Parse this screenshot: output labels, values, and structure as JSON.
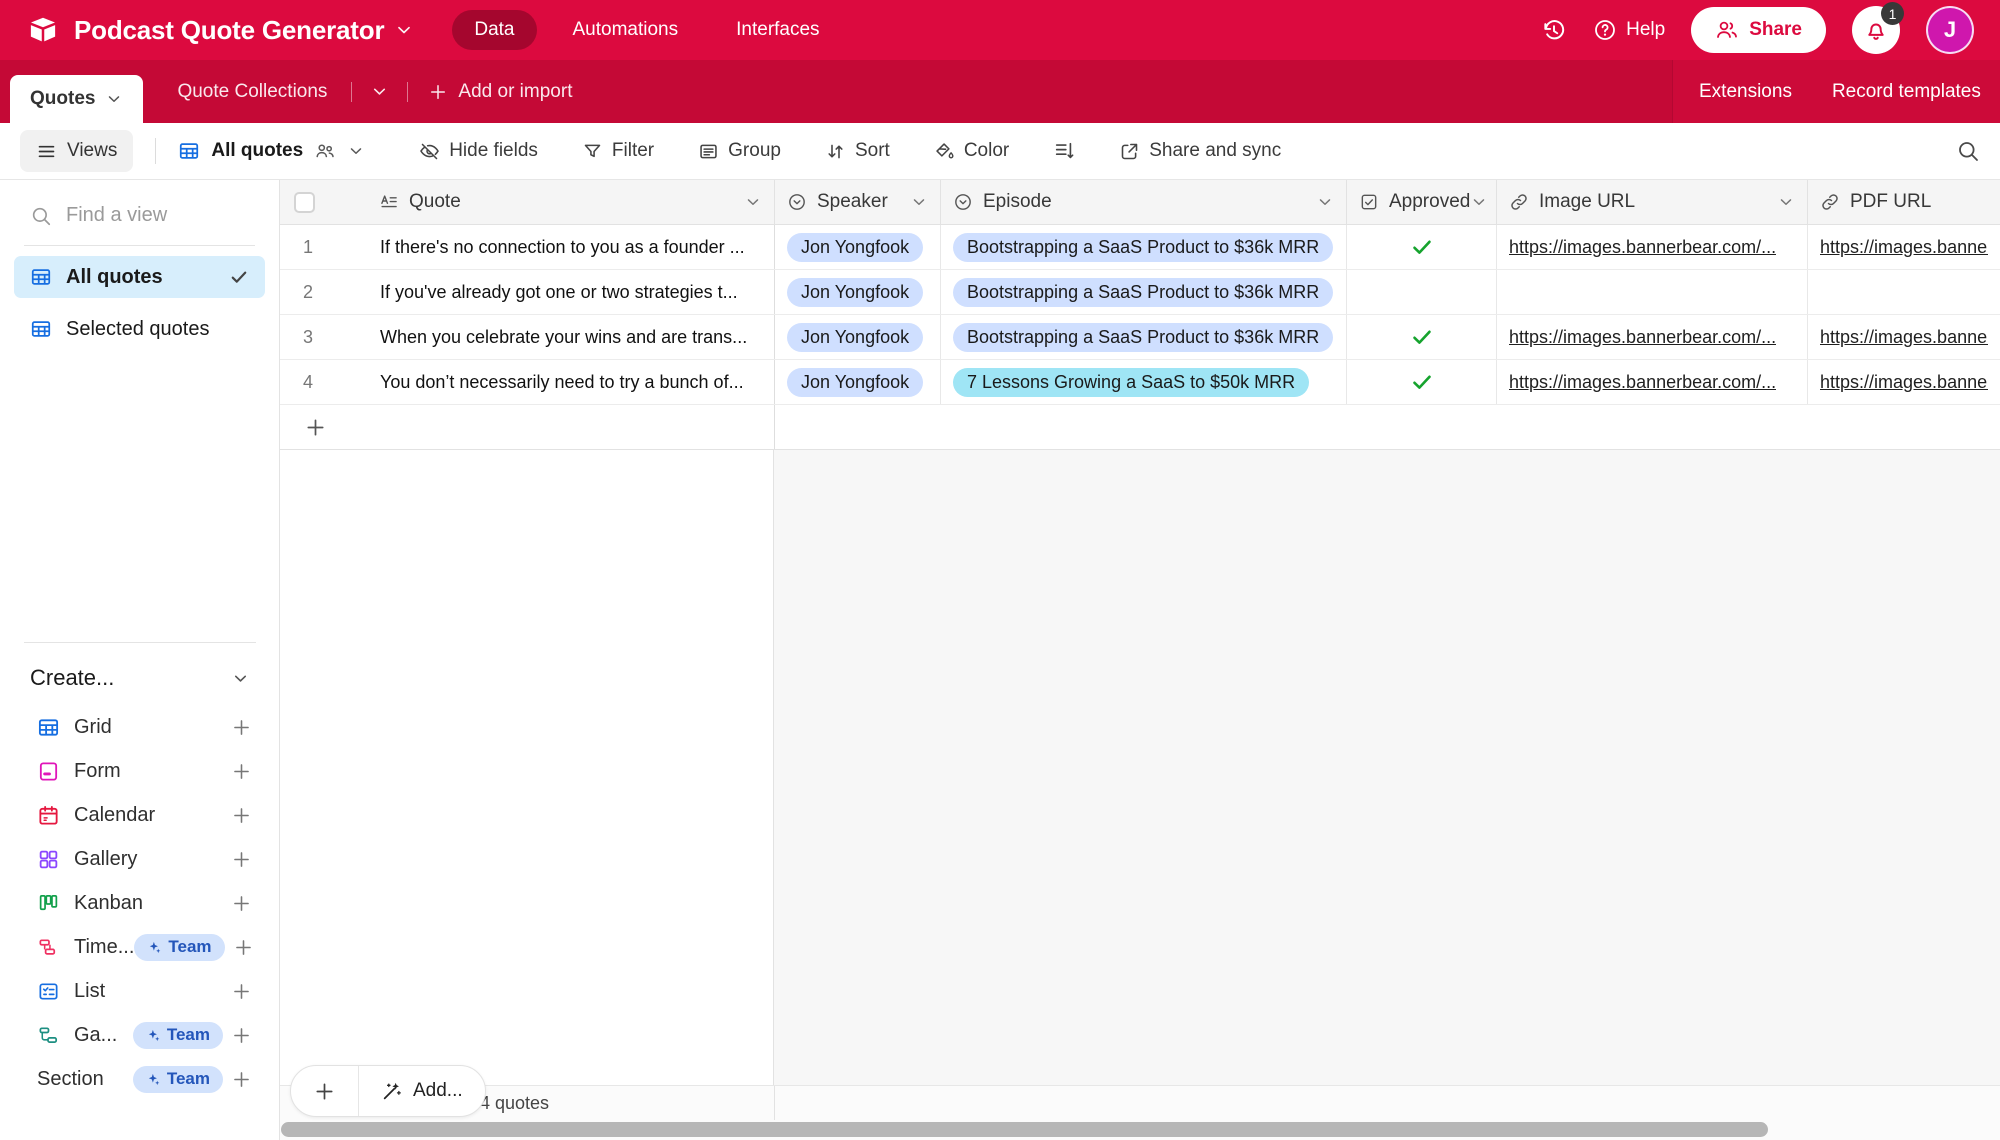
{
  "colors": {
    "header_bg": "#dc0a3f",
    "tabbar_bg": "#c40936",
    "nav_active_bg": "#a5062e",
    "accent_blue": "#166ee1",
    "selected_view_bg": "#d7eefc",
    "pill_blue": "#cfdfff",
    "pill_cyan": "#9fe5f5",
    "badge_bg": "#d2e2fc",
    "badge_text": "#2456ba",
    "check_green": "#16a32e",
    "avatar_bg": "#cf17ad"
  },
  "header": {
    "app_title": "Podcast Quote Generator",
    "nav": [
      {
        "label": "Data"
      },
      {
        "label": "Automations"
      },
      {
        "label": "Interfaces"
      }
    ],
    "help_label": "Help",
    "share_label": "Share",
    "notification_count": "1",
    "avatar_initial": "J"
  },
  "tabbar": {
    "tab_quotes": "Quotes",
    "tab_quote_collections": "Quote Collections",
    "add_or_import": "Add or import",
    "extensions": "Extensions",
    "record_templates": "Record templates"
  },
  "toolbar": {
    "views": "Views",
    "view_name": "All quotes",
    "hide_fields": "Hide fields",
    "filter": "Filter",
    "group": "Group",
    "sort": "Sort",
    "color": "Color",
    "share_and_sync": "Share and sync"
  },
  "sidebar": {
    "find_placeholder": "Find a view",
    "views": [
      {
        "label": "All quotes",
        "selected": true
      },
      {
        "label": "Selected quotes",
        "selected": false
      }
    ],
    "create_label": "Create...",
    "create_items": [
      {
        "label": "Grid",
        "badge": ""
      },
      {
        "label": "Form",
        "badge": ""
      },
      {
        "label": "Calendar",
        "badge": ""
      },
      {
        "label": "Gallery",
        "badge": ""
      },
      {
        "label": "Kanban",
        "badge": ""
      },
      {
        "label": "Time...",
        "badge": "Team"
      },
      {
        "label": "List",
        "badge": ""
      },
      {
        "label": "Ga...",
        "badge": "Team"
      },
      {
        "label": "Section",
        "badge": "Team"
      }
    ]
  },
  "table": {
    "columns": [
      "Quote",
      "Speaker",
      "Episode",
      "Approved",
      "Image URL",
      "PDF URL"
    ],
    "rows": [
      {
        "num": "1",
        "quote": "If there's no connection to you as a founder ...",
        "speaker": "Jon Yongfook",
        "episode": "Bootstrapping a SaaS Product to $36k MRR",
        "episode_bg": "#cfdfff",
        "approved": true,
        "image_url": "https://images.bannerbear.com/...",
        "pdf_url": "https://images.bannerbear.com/..."
      },
      {
        "num": "2",
        "quote": "If you've already got one or two strategies t...",
        "speaker": "Jon Yongfook",
        "episode": "Bootstrapping a SaaS Product to $36k MRR",
        "episode_bg": "#cfdfff",
        "approved": false,
        "image_url": "",
        "pdf_url": ""
      },
      {
        "num": "3",
        "quote": "When you celebrate your wins and are trans...",
        "speaker": "Jon Yongfook",
        "episode": "Bootstrapping a SaaS Product to $36k MRR",
        "episode_bg": "#cfdfff",
        "approved": true,
        "image_url": "https://images.bannerbear.com/...",
        "pdf_url": "https://images.bannerbear.com/..."
      },
      {
        "num": "4",
        "quote": "You don’t necessarily need to try a bunch of...",
        "speaker": "Jon Yongfook",
        "episode": "7 Lessons Growing a SaaS to $50k MRR",
        "episode_bg": "#9fe5f5",
        "approved": true,
        "image_url": "https://images.bannerbear.com/...",
        "pdf_url": "https://images.bannerbear.com/..."
      }
    ],
    "footer": {
      "add_label": "Add...",
      "count": "4 quotes"
    }
  }
}
